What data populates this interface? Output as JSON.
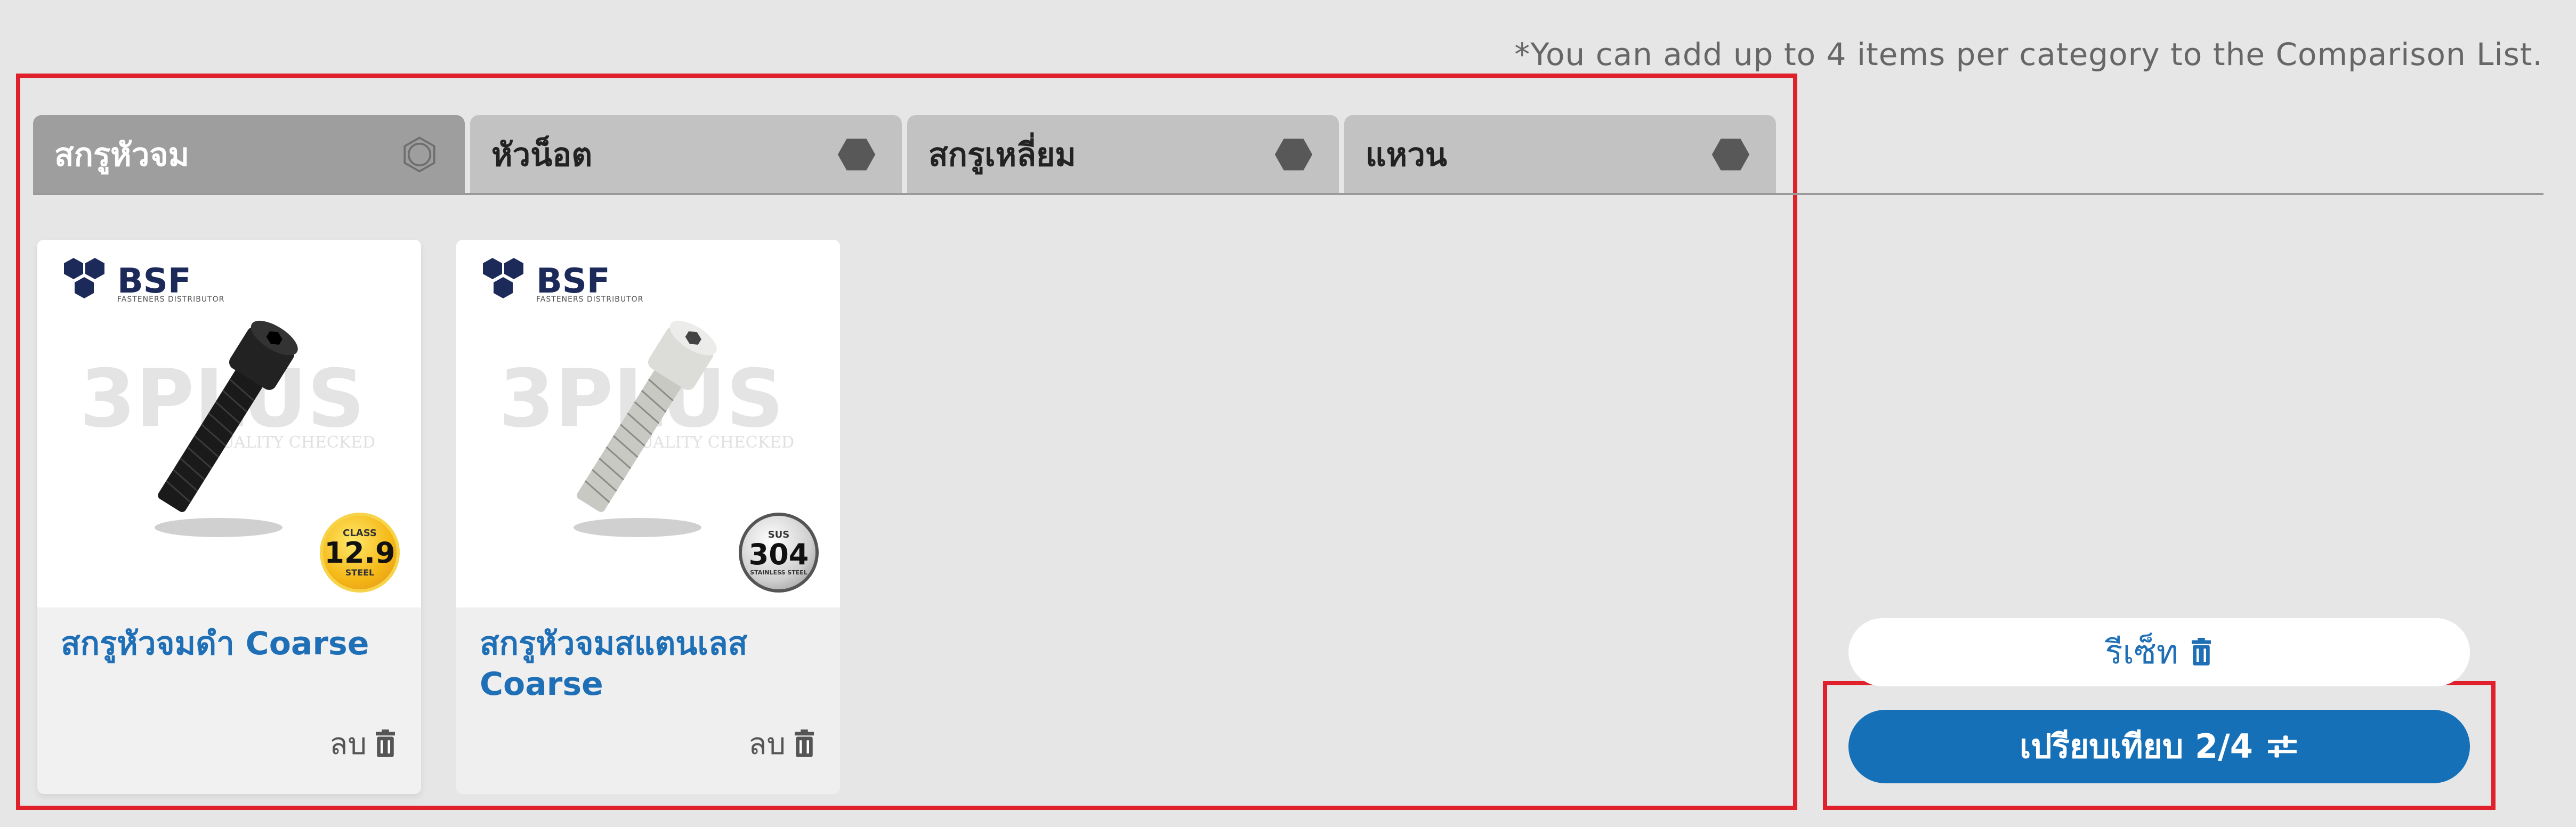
{
  "note": "*You can add up to 4 items per category to the Comparison List.",
  "tabs": [
    {
      "label": "สกรูหัวจม",
      "active": true
    },
    {
      "label": "หัวน็อต",
      "active": false
    },
    {
      "label": "สกรูเหลี่ยม",
      "active": false
    },
    {
      "label": "แหวน",
      "active": false
    }
  ],
  "products": [
    {
      "brand": "BSF",
      "brand_sub": "FASTENERS DISTRIBUTOR",
      "watermark": "3PLUS",
      "watermark_sub": "QUALITY CHECKED",
      "badge": {
        "top": "CLASS",
        "main": "12.9",
        "bottom": "STEEL",
        "color": "#f5b716"
      },
      "title": "สกรูหัวจมดำ Coarse",
      "remove_label": "ลบ"
    },
    {
      "brand": "BSF",
      "brand_sub": "FASTENERS DISTRIBUTOR",
      "watermark": "3PLUS",
      "watermark_sub": "QUALITY CHECKED",
      "badge": {
        "top": "SUS",
        "main": "304",
        "bottom": "STAINLESS STEEL",
        "color": "#cfcfcf"
      },
      "title": "สกรูหัวจมสแตนเลส Coarse",
      "remove_label": "ลบ"
    }
  ],
  "reset_label": "รีเซ็ท",
  "compare_label": "เปรียบเทียบ 2/4",
  "colors": {
    "accent": "#1570b8",
    "link": "#1f6fb6",
    "highlight": "#e0202a",
    "background": "#e6e6e6"
  }
}
